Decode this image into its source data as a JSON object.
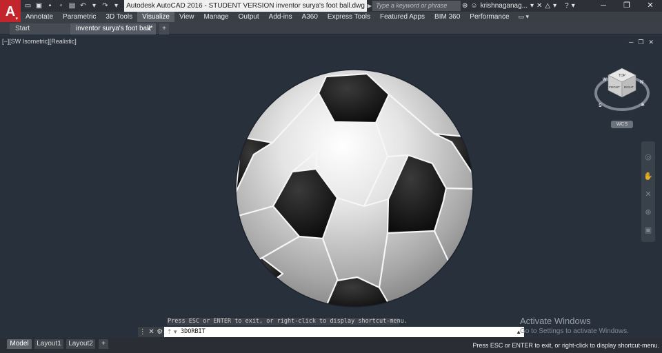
{
  "titlebar": {
    "app_logo": "A",
    "title": "Autodesk AutoCAD 2016 - STUDENT VERSION    inventor surya's foot ball.dwg",
    "search_placeholder": "Type a keyword or phrase",
    "username": "krishnaganag..."
  },
  "ribbon": {
    "tabs": [
      "Annotate",
      "Parametric",
      "3D Tools",
      "Visualize",
      "View",
      "Manage",
      "Output",
      "Add-ins",
      "A360",
      "Express Tools",
      "Featured Apps",
      "BIM 360",
      "Performance"
    ],
    "active_tab": "Visualize"
  },
  "file_tabs": {
    "start": "Start",
    "document": "inventor surya's foot ball*",
    "add": "+"
  },
  "viewport": {
    "label": "[−][SW Isometric][Realistic]",
    "viewcube": {
      "top_face": "TOP",
      "front_face": "FRONT",
      "right_face": "RIGHT",
      "compass_n": "N",
      "compass_s": "S",
      "compass_e": "E",
      "compass_w": "W",
      "wcs": "WCS"
    }
  },
  "command": {
    "hint": "Press ESC or ENTER to exit, or right-click to display shortcut-menu.",
    "value": "3DORBIT"
  },
  "watermark": {
    "title": "Activate Windows",
    "subtitle": "Go to Settings to activate Windows."
  },
  "layout_tabs": {
    "model": "Model",
    "layout1": "Layout1",
    "layout2": "Layout2",
    "add": "+"
  },
  "status": {
    "message": "Press ESC or ENTER to exit, or right-click to display shortcut-menu."
  }
}
